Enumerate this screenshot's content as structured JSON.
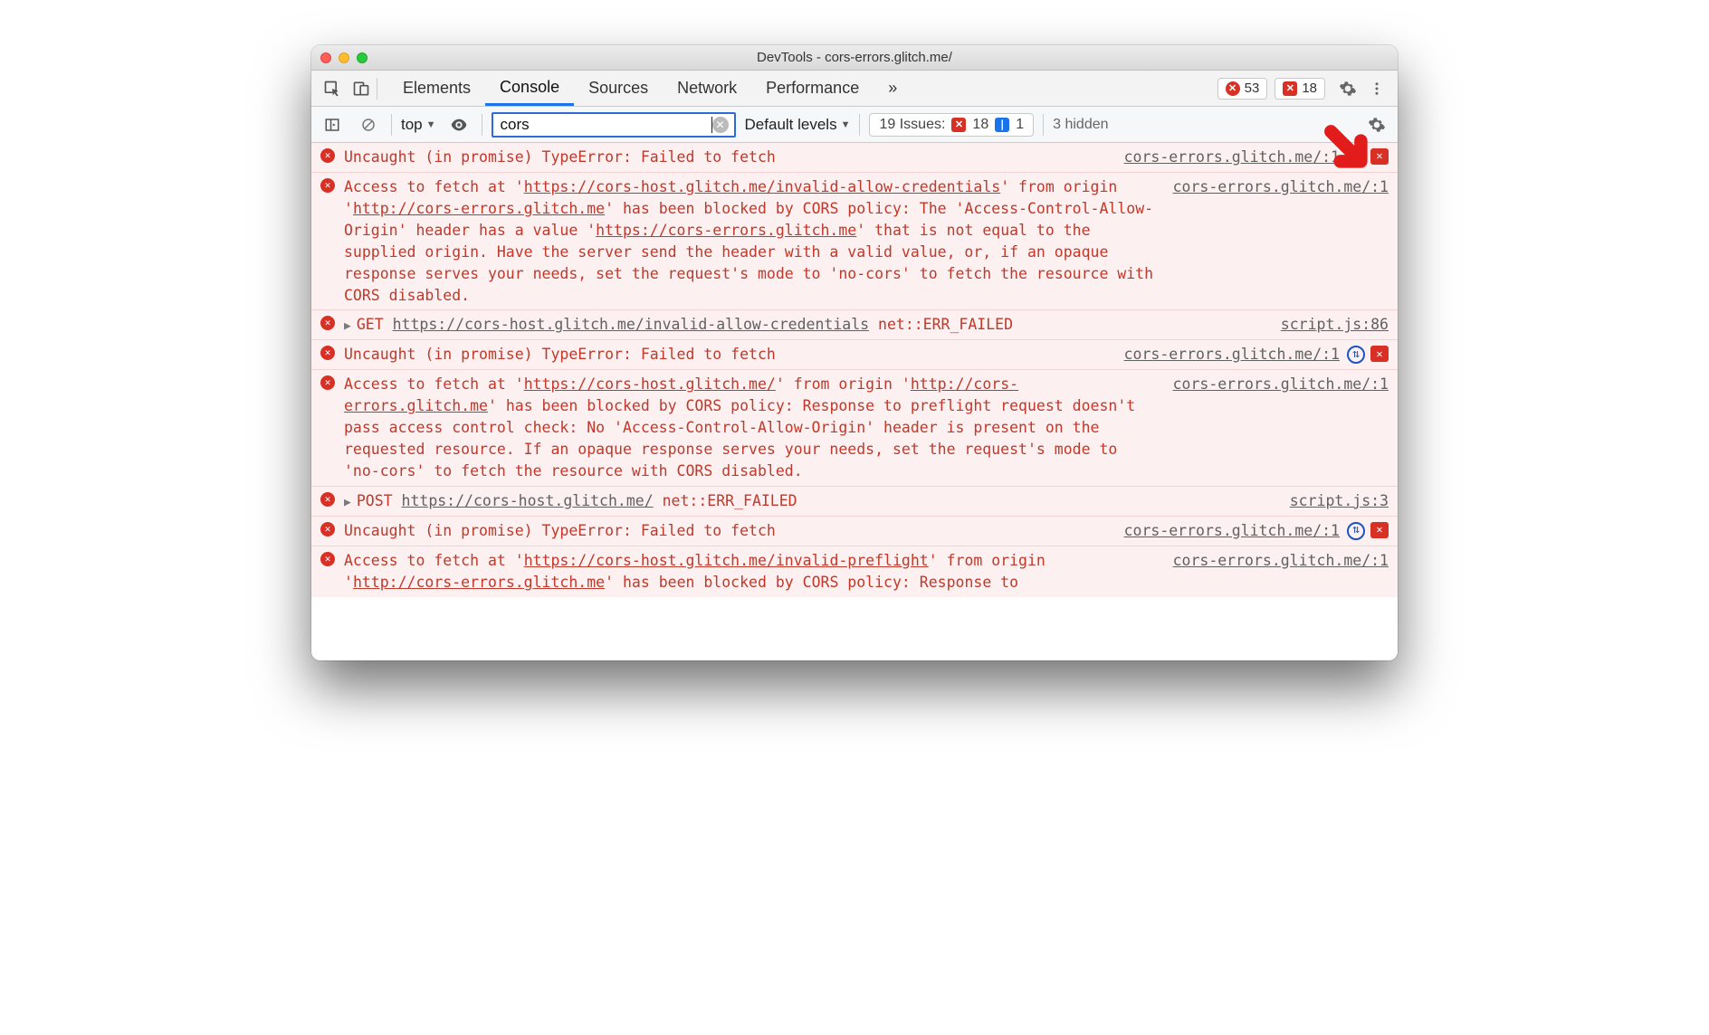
{
  "window": {
    "title": "DevTools - cors-errors.glitch.me/"
  },
  "tabs": {
    "items": [
      "Elements",
      "Console",
      "Sources",
      "Network",
      "Performance"
    ],
    "more": "»",
    "badges": {
      "errors": "53",
      "issues": "18"
    }
  },
  "filter": {
    "context": "top",
    "search_value": "cors",
    "levels": "Default levels",
    "issues_label": "19 Issues:",
    "issues_err": "18",
    "issues_info": "1",
    "hidden": "3 hidden"
  },
  "src": {
    "main": "cors-errors.glitch.me/:1",
    "script86": "script.js:86",
    "script3": "script.js:3"
  },
  "msgs": {
    "uncaught": "Uncaught (in promise) TypeError: Failed to fetch",
    "m1a": "Access to fetch at '",
    "m1u1": "https://cors-host.glitch.me/invalid-allow-credentials",
    "m1b": "' from origin '",
    "m1u2": "http://cors-errors.glitch.me",
    "m1c": "' has been blocked by CORS policy: The 'Access-Control-Allow-Origin' header has a value '",
    "m1u3": "https://cors-errors.glitch.me",
    "m1d": "' that is not equal to the supplied origin. Have the server send the header with a valid value, or, if an opaque response serves your needs, set the request's mode to 'no-cors' to fetch the resource with CORS disabled.",
    "m2method": "GET",
    "m2url": "https://cors-host.glitch.me/invalid-allow-credentials",
    "m2err": " net::ERR_FAILED",
    "m3a": "Access to fetch at '",
    "m3u1": "https://cors-host.glitch.me/",
    "m3b": "' from origin '",
    "m3u2": "http://cors-errors.glitch.me",
    "m3c": "' has been blocked by CORS policy: Response to preflight request doesn't pass access control check: No 'Access-Control-Allow-Origin' header is present on the requested resource. If an opaque response serves your needs, set the request's mode to 'no-cors' to fetch the resource with CORS disabled.",
    "m4method": "POST",
    "m4url": "https://cors-host.glitch.me/",
    "m4err": " net::ERR_FAILED",
    "m5a": "Access to fetch at '",
    "m5u1": "https://cors-host.glitch.me/invalid-preflight",
    "m5b": "' from origin '",
    "m5u2": "http://cors-errors.glitch.me",
    "m5c": "' has been blocked by CORS policy: Response to"
  }
}
